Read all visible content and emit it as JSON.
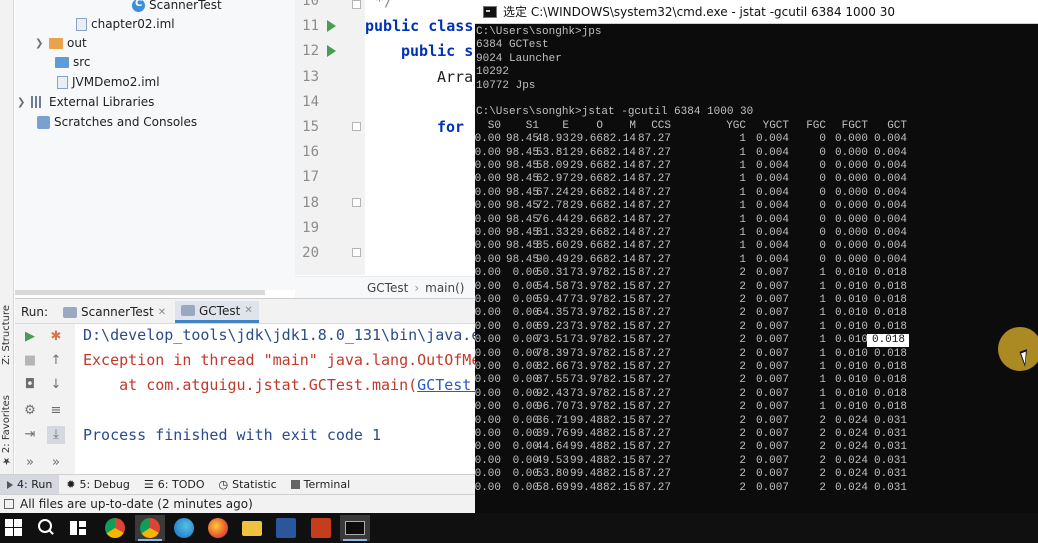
{
  "project_tree": {
    "items": [
      {
        "label": "ScannerTest",
        "icon": "class-icon"
      },
      {
        "label": "chapter02.iml",
        "icon": "iml-file-icon"
      },
      {
        "label": "out",
        "icon": "folder-orange-icon"
      },
      {
        "label": "src",
        "icon": "folder-blue-icon"
      },
      {
        "label": "JVMDemo2.iml",
        "icon": "iml-file-icon"
      },
      {
        "label": "External Libraries",
        "icon": "libraries-icon"
      },
      {
        "label": "Scratches and Consoles",
        "icon": "scratches-icon"
      }
    ]
  },
  "side_stripe": {
    "structure": "Z: Structure",
    "favorites": "2: Favorites"
  },
  "editor": {
    "line_numbers": [
      "10",
      "11",
      "12",
      "13",
      "14",
      "15",
      "16",
      "17",
      "18",
      "19",
      "20"
    ],
    "code_lines": [
      {
        "line": "10",
        "kw": "",
        "text": "*/"
      },
      {
        "line": "11",
        "kw": "public class",
        "text": ""
      },
      {
        "line": "12",
        "kw": "public s",
        "text": ""
      },
      {
        "line": "13",
        "kw": "",
        "text": "Arra"
      },
      {
        "line": "15",
        "kw": "for",
        "text": ""
      }
    ],
    "breadcrumb": [
      "GCTest",
      "main()"
    ]
  },
  "run": {
    "title": "Run:",
    "tabs": [
      {
        "label": "ScannerTest"
      },
      {
        "label": "GCTest"
      }
    ],
    "console": [
      {
        "text": "D:\\develop_tools\\jdk\\jdk1.8.0_131\\bin\\java.e",
        "color": "#2a4b8d"
      },
      {
        "text": "Exception in thread \"main\" java.lang.OutOfMe",
        "color": "#c0392b"
      },
      {
        "text": "    at com.atguigu.jstat.GCTest.main(",
        "color": "#c0392b",
        "link": "GCTest.j"
      },
      {
        "text": "",
        "color": "#2a4b8d"
      },
      {
        "text": "Process finished with exit code 1",
        "color": "#2a4b8d"
      }
    ]
  },
  "bottom_tabs": [
    {
      "label": "4: Run",
      "active": true
    },
    {
      "label": "5: Debug"
    },
    {
      "label": "6: TODO"
    },
    {
      "label": "Statistic"
    },
    {
      "label": "Terminal"
    }
  ],
  "status": {
    "text": "All files are up-to-date (2 minutes ago)"
  },
  "cmd": {
    "title": "选定 C:\\WINDOWS\\system32\\cmd.exe - jstat  -gcutil 6384 1000 30",
    "lines_top": [
      "C:\\Users\\songhk>jps",
      "6384 GCTest",
      "9024 Launcher",
      "10292",
      "10772 Jps",
      "",
      "C:\\Users\\songhk>jstat -gcutil 6384 1000 30"
    ],
    "headers": [
      "S0",
      "S1",
      "E",
      "O",
      "M",
      "CCS",
      "YGC",
      "YGCT",
      "FGC",
      "FGCT",
      "GCT"
    ],
    "rows": [
      [
        "0.00",
        "98.45",
        "48.93",
        "29.66",
        "82.14",
        "87.27",
        "1",
        "0.004",
        "0",
        "0.000",
        "0.004"
      ],
      [
        "0.00",
        "98.45",
        "53.81",
        "29.66",
        "82.14",
        "87.27",
        "1",
        "0.004",
        "0",
        "0.000",
        "0.004"
      ],
      [
        "0.00",
        "98.45",
        "58.09",
        "29.66",
        "82.14",
        "87.27",
        "1",
        "0.004",
        "0",
        "0.000",
        "0.004"
      ],
      [
        "0.00",
        "98.45",
        "62.97",
        "29.66",
        "82.14",
        "87.27",
        "1",
        "0.004",
        "0",
        "0.000",
        "0.004"
      ],
      [
        "0.00",
        "98.45",
        "67.24",
        "29.66",
        "82.14",
        "87.27",
        "1",
        "0.004",
        "0",
        "0.000",
        "0.004"
      ],
      [
        "0.00",
        "98.45",
        "72.78",
        "29.66",
        "82.14",
        "87.27",
        "1",
        "0.004",
        "0",
        "0.000",
        "0.004"
      ],
      [
        "0.00",
        "98.45",
        "76.44",
        "29.66",
        "82.14",
        "87.27",
        "1",
        "0.004",
        "0",
        "0.000",
        "0.004"
      ],
      [
        "0.00",
        "98.45",
        "81.33",
        "29.66",
        "82.14",
        "87.27",
        "1",
        "0.004",
        "0",
        "0.000",
        "0.004"
      ],
      [
        "0.00",
        "98.45",
        "85.60",
        "29.66",
        "82.14",
        "87.27",
        "1",
        "0.004",
        "0",
        "0.000",
        "0.004"
      ],
      [
        "0.00",
        "98.45",
        "90.49",
        "29.66",
        "82.14",
        "87.27",
        "1",
        "0.004",
        "0",
        "0.000",
        "0.004"
      ],
      [
        "0.00",
        "0.00",
        "50.31",
        "73.97",
        "82.15",
        "87.27",
        "2",
        "0.007",
        "1",
        "0.010",
        "0.018"
      ],
      [
        "0.00",
        "0.00",
        "54.58",
        "73.97",
        "82.15",
        "87.27",
        "2",
        "0.007",
        "1",
        "0.010",
        "0.018"
      ],
      [
        "0.00",
        "0.00",
        "59.47",
        "73.97",
        "82.15",
        "87.27",
        "2",
        "0.007",
        "1",
        "0.010",
        "0.018"
      ],
      [
        "0.00",
        "0.00",
        "64.35",
        "73.97",
        "82.15",
        "87.27",
        "2",
        "0.007",
        "1",
        "0.010",
        "0.018"
      ],
      [
        "0.00",
        "0.00",
        "69.23",
        "73.97",
        "82.15",
        "87.27",
        "2",
        "0.007",
        "1",
        "0.010",
        "0.018"
      ],
      [
        "0.00",
        "0.00",
        "73.51",
        "73.97",
        "82.15",
        "87.27",
        "2",
        "0.007",
        "1",
        "0.010",
        "0.018"
      ],
      [
        "0.00",
        "0.00",
        "78.39",
        "73.97",
        "82.15",
        "87.27",
        "2",
        "0.007",
        "1",
        "0.010",
        "0.018"
      ],
      [
        "0.00",
        "0.00",
        "82.66",
        "73.97",
        "82.15",
        "87.27",
        "2",
        "0.007",
        "1",
        "0.010",
        "0.018"
      ],
      [
        "0.00",
        "0.00",
        "87.55",
        "73.97",
        "82.15",
        "87.27",
        "2",
        "0.007",
        "1",
        "0.010",
        "0.018"
      ],
      [
        "0.00",
        "0.00",
        "92.43",
        "73.97",
        "82.15",
        "87.27",
        "2",
        "0.007",
        "1",
        "0.010",
        "0.018"
      ],
      [
        "0.00",
        "0.00",
        "96.70",
        "73.97",
        "82.15",
        "87.27",
        "2",
        "0.007",
        "1",
        "0.010",
        "0.018"
      ],
      [
        "0.00",
        "0.00",
        "36.71",
        "99.48",
        "82.15",
        "87.27",
        "2",
        "0.007",
        "2",
        "0.024",
        "0.031"
      ],
      [
        "0.00",
        "0.00",
        "39.76",
        "99.48",
        "82.15",
        "87.27",
        "2",
        "0.007",
        "2",
        "0.024",
        "0.031"
      ],
      [
        "0.00",
        "0.00",
        "44.64",
        "99.48",
        "82.15",
        "87.27",
        "2",
        "0.007",
        "2",
        "0.024",
        "0.031"
      ],
      [
        "0.00",
        "0.00",
        "49.53",
        "99.48",
        "82.15",
        "87.27",
        "2",
        "0.007",
        "2",
        "0.024",
        "0.031"
      ],
      [
        "0.00",
        "0.00",
        "53.80",
        "99.48",
        "82.15",
        "87.27",
        "2",
        "0.007",
        "2",
        "0.024",
        "0.031"
      ],
      [
        "0.00",
        "0.00",
        "58.69",
        "99.48",
        "82.15",
        "87.27",
        "2",
        "0.007",
        "2",
        "0.024",
        "0.031"
      ]
    ],
    "selected_cell": {
      "row": 15,
      "col": 10
    }
  },
  "taskbar": {
    "apps": [
      "start-icon",
      "search-icon",
      "task-view-icon",
      "chrome-icon",
      "chrome-icon",
      "edge-icon",
      "firefox-icon",
      "file-explorer-icon",
      "word-icon",
      "powerpoint-icon",
      "cmd-icon"
    ]
  },
  "colors": {
    "accent": "#4083c9",
    "cmd_bg": "#0c0c0c",
    "cmd_text": "#c0c0c0",
    "error_text": "#c0392b",
    "console_text": "#2a4b8d",
    "cursor_highlight": "#c8a028"
  }
}
